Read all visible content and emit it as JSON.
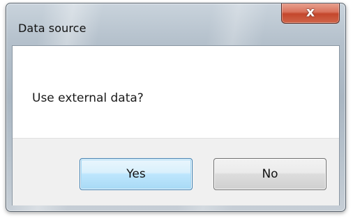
{
  "window": {
    "title": "Data source",
    "close_icon": "close-icon",
    "close_glyph": "x"
  },
  "message": {
    "text": "Use external data?"
  },
  "buttons": {
    "yes_label": "Yes",
    "no_label": "No"
  },
  "colors": {
    "close_button": "#c4472c",
    "default_button_border": "#3c7fb1",
    "button_area": "#f0f0f0"
  }
}
